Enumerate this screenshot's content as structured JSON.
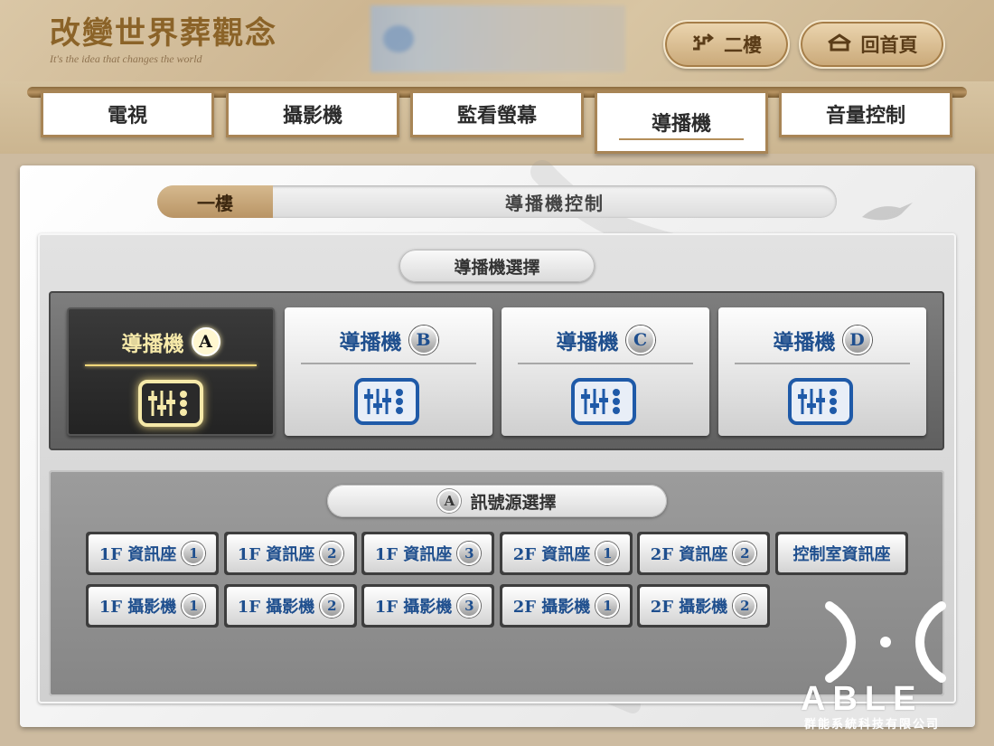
{
  "header": {
    "logo_title": "改變世界葬觀念",
    "logo_subtitle": "It's the idea that changes the world",
    "floor_button": "二樓",
    "home_button": "回首頁"
  },
  "tabs": [
    {
      "label": "電視",
      "active": false
    },
    {
      "label": "攝影機",
      "active": false
    },
    {
      "label": "監看螢幕",
      "active": false
    },
    {
      "label": "導播機",
      "active": true
    },
    {
      "label": "音量控制",
      "active": false
    }
  ],
  "panel": {
    "floor": "一樓",
    "title": "導播機控制",
    "switcher_heading": "導播機選擇",
    "switchers": [
      {
        "label": "導播機",
        "letter": "A",
        "active": true
      },
      {
        "label": "導播機",
        "letter": "B",
        "active": false
      },
      {
        "label": "導播機",
        "letter": "C",
        "active": false
      },
      {
        "label": "導播機",
        "letter": "D",
        "active": false
      }
    ],
    "source_heading_letter": "A",
    "source_heading": "訊號源選擇",
    "sources_row1": [
      {
        "label": "1F 資訊座",
        "num": "1"
      },
      {
        "label": "1F 資訊座",
        "num": "2"
      },
      {
        "label": "1F 資訊座",
        "num": "3"
      },
      {
        "label": "2F 資訊座",
        "num": "1"
      },
      {
        "label": "2F 資訊座",
        "num": "2"
      },
      {
        "label": "控制室資訊座",
        "num": ""
      }
    ],
    "sources_row2": [
      {
        "label": "1F 攝影機",
        "num": "1"
      },
      {
        "label": "1F 攝影機",
        "num": "2"
      },
      {
        "label": "1F 攝影機",
        "num": "3"
      },
      {
        "label": "2F 攝影機",
        "num": "1"
      },
      {
        "label": "2F 攝影機",
        "num": "2"
      }
    ]
  },
  "brand": {
    "name": "ABLE",
    "company": "群能系統科技有限公司"
  },
  "colors": {
    "accent_blue": "#1f4f8e",
    "gold": "#b48e5a",
    "active_glow": "#f6e9a9"
  }
}
